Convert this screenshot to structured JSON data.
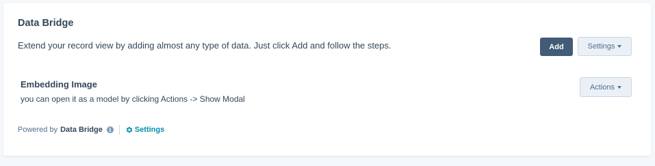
{
  "card": {
    "title": "Data Bridge",
    "description": "Extend your record view by adding almost any type of data. Just click Add and follow the steps.",
    "add_label": "Add",
    "settings_label": "Settings"
  },
  "item": {
    "title": "Embedding Image",
    "description": "you can open it as a model by clicking Actions -> Show Modal",
    "actions_label": "Actions"
  },
  "footer": {
    "powered_by": "Powered by",
    "brand": "Data Bridge",
    "settings_link": "Settings",
    "info_icon": "info-icon",
    "settings_icon": "gear-icon"
  },
  "colors": {
    "primary_button": "#425b76",
    "link": "#0091ae",
    "text": "#33475b"
  }
}
